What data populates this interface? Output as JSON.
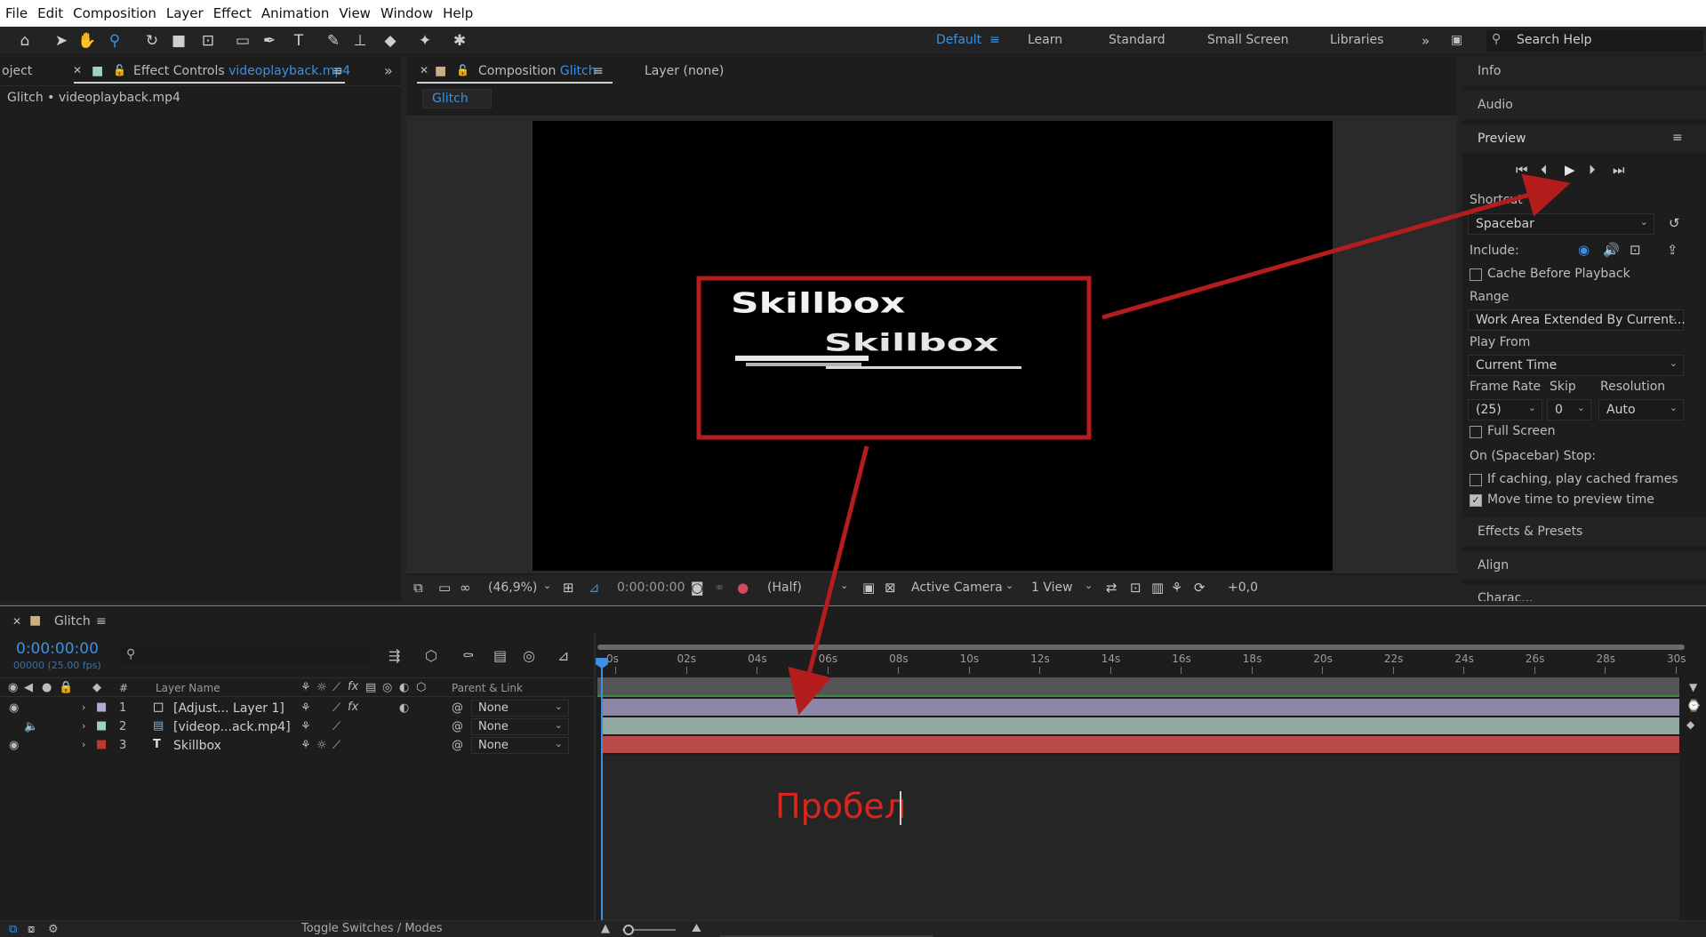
{
  "menubar": [
    "File",
    "Edit",
    "Composition",
    "Layer",
    "Effect",
    "Animation",
    "View",
    "Window",
    "Help"
  ],
  "toolbar": {
    "tools": [
      "home-icon",
      "selection-icon",
      "hand-icon",
      "zoom-icon",
      "rotate-icon",
      "camera-icon",
      "pan-behind-icon",
      "rectangle-icon",
      "pen-icon",
      "type-icon",
      "brush-icon",
      "clone-stamp-icon",
      "eraser-icon",
      "roto-brush-icon",
      "puppet-icon"
    ],
    "workspaces": [
      {
        "label": "Default",
        "active": true
      },
      {
        "label": "Learn",
        "active": false
      },
      {
        "label": "Standard",
        "active": false
      },
      {
        "label": "Small Screen",
        "active": false
      },
      {
        "label": "Libraries",
        "active": false
      }
    ],
    "search_placeholder": "Search Help"
  },
  "effect_panel": {
    "tab_project": "oject",
    "tab_effect_prefix": "Effect Controls ",
    "tab_effect_file": "videoplayback.mp4",
    "breadcrumb": "Glitch • videoplayback.mp4"
  },
  "comp_panel": {
    "tab_prefix": "Composition ",
    "tab_name": "Glitch",
    "layer_tab": "Layer  (none)",
    "sub_tab": "Glitch",
    "canvas_text": "Skillbox",
    "footer": {
      "zoom": "(46,9%)",
      "timecode": "0:00:00:00",
      "resolution": "(Half)",
      "camera": "Active Camera",
      "views": "1 View",
      "exposure": "+0,0"
    }
  },
  "right_panel": {
    "info": "Info",
    "audio": "Audio",
    "preview": "Preview",
    "shortcut_label": "Shortcut",
    "shortcut_value": "Spacebar",
    "include_label": "Include:",
    "cache_before_playback": "Cache Before Playback",
    "range_label": "Range",
    "range_value": "Work Area Extended By Current...",
    "play_from_label": "Play From",
    "play_from_value": "Current Time",
    "frame_rate_label": "Frame Rate",
    "skip_label": "Skip",
    "resolution_label": "Resolution",
    "frame_rate_value": "(25)",
    "skip_value": "0",
    "resolution_value": "Auto",
    "full_screen": "Full Screen",
    "on_stop_label": "On (Spacebar) Stop:",
    "if_caching": "If caching, play cached frames",
    "move_time": "Move time to preview time",
    "move_time_checked": true,
    "effects_presets": "Effects & Presets",
    "align": "Align",
    "character_cut": "Charac..."
  },
  "timeline": {
    "tab_name": "Glitch",
    "timecode": "0:00:00:00",
    "fps": "00000 (25.00 fps)",
    "search_placeholder": "",
    "col_number": "#",
    "col_layer_name": "Layer Name",
    "col_parent": "Parent & Link",
    "ruler": [
      "0s",
      "02s",
      "04s",
      "06s",
      "08s",
      "10s",
      "12s",
      "14s",
      "16s",
      "18s",
      "20s",
      "22s",
      "24s",
      "26s",
      "28s",
      "30s"
    ],
    "layers": [
      {
        "num": "1",
        "name": "[Adjust... Layer 1]",
        "color": "#b4a6d6",
        "parent": "None",
        "track_color": "#8e86a6",
        "type": "adjustment"
      },
      {
        "num": "2",
        "name": "[videop...ack.mp4]",
        "color": "#9ed1c2",
        "parent": "None",
        "track_color": "#8fa8a0",
        "type": "footage"
      },
      {
        "num": "3",
        "name": "Skillbox",
        "color": "#c0392b",
        "parent": "None",
        "track_color": "#b84a4a",
        "type": "text"
      }
    ],
    "annotation": "Пробел",
    "footer_toggle": "Toggle Switches / Modes"
  },
  "colors": {
    "accent": "#3d8fe0",
    "annotation_red": "#d6261e",
    "arrow_red": "#b51d1d"
  }
}
